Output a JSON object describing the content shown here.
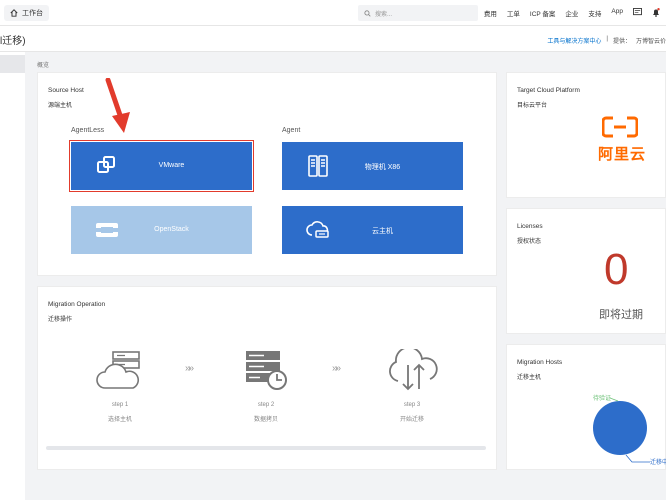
{
  "topbar": {
    "workbench": "工作台",
    "search_placeholder": "搜索...",
    "nav": [
      "费用",
      "工单",
      "ICP 备案",
      "企业",
      "支持",
      "App"
    ]
  },
  "subheader": {
    "title": "l迁移)",
    "link": "工具与解决方案中心",
    "divider": "|",
    "provider_label": "提供：",
    "provider": "万博智云价"
  },
  "breadcrumb": "概览",
  "source_host": {
    "title_en": "Source Host",
    "title_cn": "源端主机",
    "agentless_label": "AgentLess",
    "agent_label": "Agent",
    "tiles": {
      "vmware": "VMware",
      "openstack": "OpenStack",
      "physical": "物理机 X86",
      "cloud_host": "云主机"
    }
  },
  "migration_operation": {
    "title_en": "Migration Operation",
    "title_cn": "迁移操作",
    "steps": [
      {
        "num": "step 1",
        "label": "选择主机"
      },
      {
        "num": "step 2",
        "label": "数据拷贝"
      },
      {
        "num": "step 3",
        "label": "开始迁移"
      }
    ],
    "separator": "»»"
  },
  "target_platform": {
    "title_en": "Target Cloud Platform",
    "title_cn": "目标云平台",
    "logo_text": "阿里云"
  },
  "licenses": {
    "title_en": "Licenses",
    "title_cn": "授权状态",
    "count": "0",
    "status": "即将过期"
  },
  "migration_hosts": {
    "title_en": "Migration Hosts",
    "title_cn": "迁移主机",
    "legend_pending": "待验证",
    "legend_migrating": "迁移中"
  },
  "colors": {
    "accent": "#2d6dca",
    "tile_disabled": "#a6c7e8",
    "highlight_border": "#e23b2c",
    "aliyun_orange": "#ff6a00",
    "license_red": "#c0392b"
  }
}
